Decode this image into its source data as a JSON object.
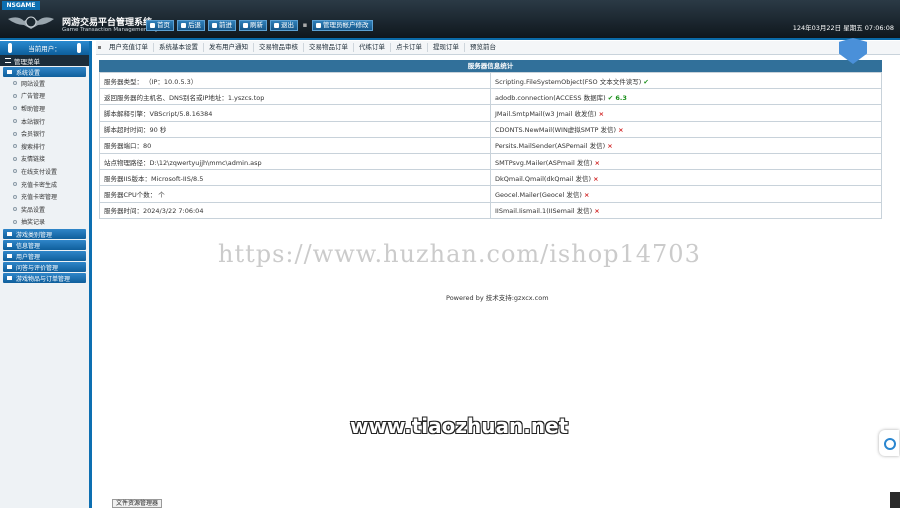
{
  "header": {
    "badge": "NSGAME",
    "title": "网游交易平台管理系统",
    "subtitle": "Game Transaction Management System",
    "toolbar": [
      {
        "label": "首页",
        "icon": "home-icon"
      },
      {
        "label": "后退",
        "icon": "back-icon"
      },
      {
        "label": "前进",
        "icon": "forward-icon"
      },
      {
        "label": "刷新",
        "icon": "refresh-icon"
      },
      {
        "label": "退出",
        "icon": "logout-icon"
      }
    ],
    "toolbar_extra": "管理员帐户修改",
    "datetime": "124年03月22日 星期五 07:06:08"
  },
  "subnav": [
    "用户充值订单",
    "系统基本设置",
    "发布用户通知",
    "交易物品审核",
    "交易物品订单",
    "代练订单",
    "点卡订单",
    "提现订单",
    "预览前台"
  ],
  "sidebar": {
    "user_label": "当前用户：",
    "menu_title": "管理菜单",
    "groups": [
      {
        "label": "系统设置",
        "items": [
          "网站设置",
          "广告管理",
          "帮助管理",
          "本站银行",
          "会员银行",
          "搜索排行",
          "友情链接",
          "在线支付设置",
          "充值卡密生成",
          "充值卡密管理",
          "奖品设置",
          "抽奖记录"
        ]
      },
      {
        "label": "游戏类别管理",
        "items": []
      },
      {
        "label": "信息管理",
        "items": []
      },
      {
        "label": "用户管理",
        "items": []
      },
      {
        "label": "问答与评价管理",
        "items": []
      },
      {
        "label": "游戏物品与订单管理",
        "items": []
      }
    ]
  },
  "panel": {
    "title": "服务器信息统计",
    "rows": [
      {
        "left": "服务器类型：  （IP：10.0.5.3）",
        "right": "Scripting.FileSystemObject(FSO 文本文件读写)",
        "status": "ok",
        "mark": "✔"
      },
      {
        "left": "返回服务器的主机名、DNS别名或IP地址：1.yszcs.top",
        "right": "adodb.connection(ACCESS 数据库)",
        "status": "ok",
        "mark": "✔ 6.3"
      },
      {
        "left": "脚本解释引擎：VBScript/5.8.16384",
        "right": "JMail.SmtpMail(w3 Jmail 收发信)",
        "status": "no",
        "mark": "×"
      },
      {
        "left": "脚本超时时间：90 秒",
        "right": "CDONTS.NewMail(WIN虚拟SMTP 发信)",
        "status": "no",
        "mark": "×"
      },
      {
        "left": "服务器端口：80",
        "right": "Persits.MailSender(ASPemail 发信)",
        "status": "no",
        "mark": "×"
      },
      {
        "left": "站点物理路径：D:\\12\\zqwertyujjh\\mmc\\admin.asp",
        "right": "SMTPsvg.Mailer(ASPmail 发信)",
        "status": "no",
        "mark": "×"
      },
      {
        "left": "服务器IIS版本：Microsoft-IIS/8.5",
        "right": "DkQmail.Qmail(dkQmail 发信)",
        "status": "no",
        "mark": "×"
      },
      {
        "left": "服务器CPU个数：  个",
        "right": "Geocel.Mailer(Geocel 发信)",
        "status": "no",
        "mark": "×"
      },
      {
        "left": "服务器时间：2024/3/22 7:06:04",
        "right": "IISmail.Iismail.1(IISemail 发信)",
        "status": "no",
        "mark": "×"
      }
    ]
  },
  "footer": {
    "powered": "Powered by 技术支持:gzxcx.com"
  },
  "watermarks": {
    "url": "https://www.huzhan.com/ishop14703",
    "site": "www.tiaozhuan.net"
  },
  "statusbar": {
    "label": "文件资源管理器"
  },
  "colors": {
    "accent": "#0d6fb1",
    "ok": "#1a8f1a",
    "fail": "#d02020",
    "panel_head": "#31709a"
  }
}
